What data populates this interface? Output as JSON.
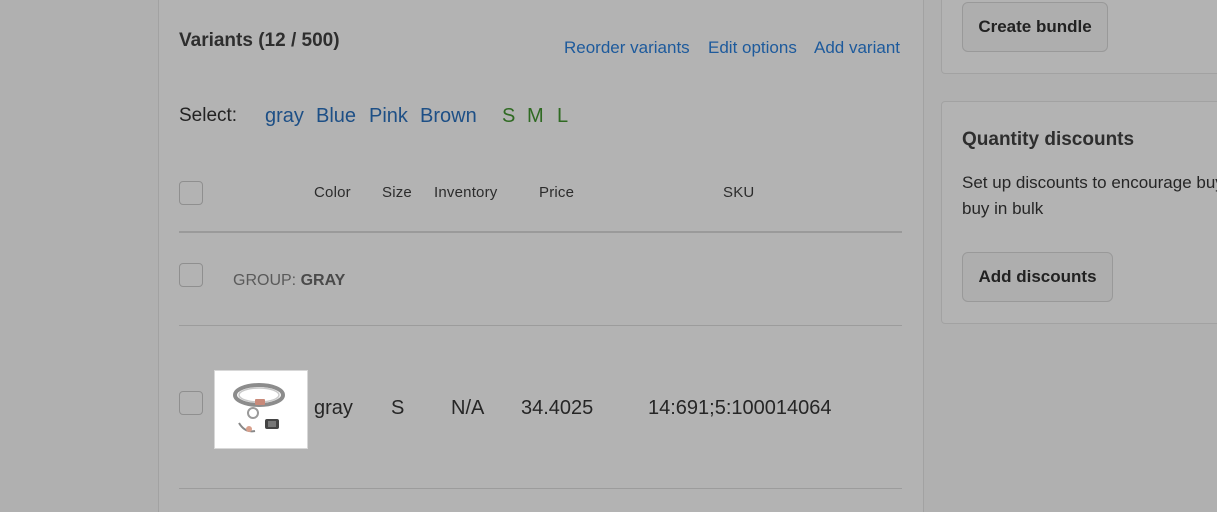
{
  "variants": {
    "title": "Variants (12 / 500)",
    "actions": {
      "reorder": "Reorder variants",
      "edit_options": "Edit options",
      "add_variant": "Add variant"
    },
    "select": {
      "label": "Select:",
      "colors": [
        "gray",
        "Blue",
        "Pink",
        "Brown"
      ],
      "sizes": [
        "S",
        "M",
        "L"
      ]
    },
    "table": {
      "headers": {
        "color": "Color",
        "size": "Size",
        "inventory": "Inventory",
        "price": "Price",
        "sku": "SKU"
      },
      "group": {
        "prefix": "GROUP:",
        "value": "GRAY"
      },
      "rows": [
        {
          "color": "gray",
          "size": "S",
          "inventory": "N/A",
          "price": "34.4025",
          "sku": "14:691;5:100014064"
        }
      ]
    }
  },
  "sidebar": {
    "bundle_button": "Create bundle",
    "quantity_discounts": {
      "title": "Quantity discounts",
      "description_line1": "Set up discounts to encourage buyers to",
      "description_line2": "buy in bulk",
      "button": "Add discounts"
    }
  },
  "colors": {
    "link": "#1d5a9c",
    "color_filter": "#1d4f86",
    "size_filter": "#2f6a22",
    "background": "#b0b0b0"
  }
}
